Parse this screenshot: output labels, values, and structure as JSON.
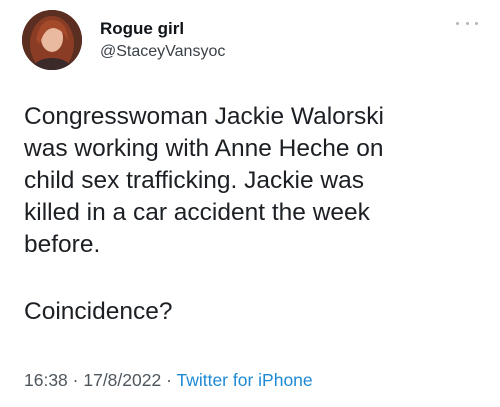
{
  "tweet": {
    "display_name": "Rogue girl",
    "handle": "@StaceyVansyoc",
    "text_lines": [
      "Congresswoman Jackie Walorski",
      "was working with Anne Heche on",
      "child sex trafficking. Jackie was",
      "killed in a car accident the week",
      "before."
    ],
    "text_second_paragraph": "Coincidence?",
    "time": "16:38",
    "separator_1": " · ",
    "date": "17/8/2022",
    "separator_2": " · ",
    "source": "Twitter for iPhone",
    "avatar_icon": "profile-photo",
    "more_icon": "more-options-icon"
  },
  "colors": {
    "link": "#1d8ad6",
    "text": "#1c2024",
    "meta": "#4e565d"
  }
}
